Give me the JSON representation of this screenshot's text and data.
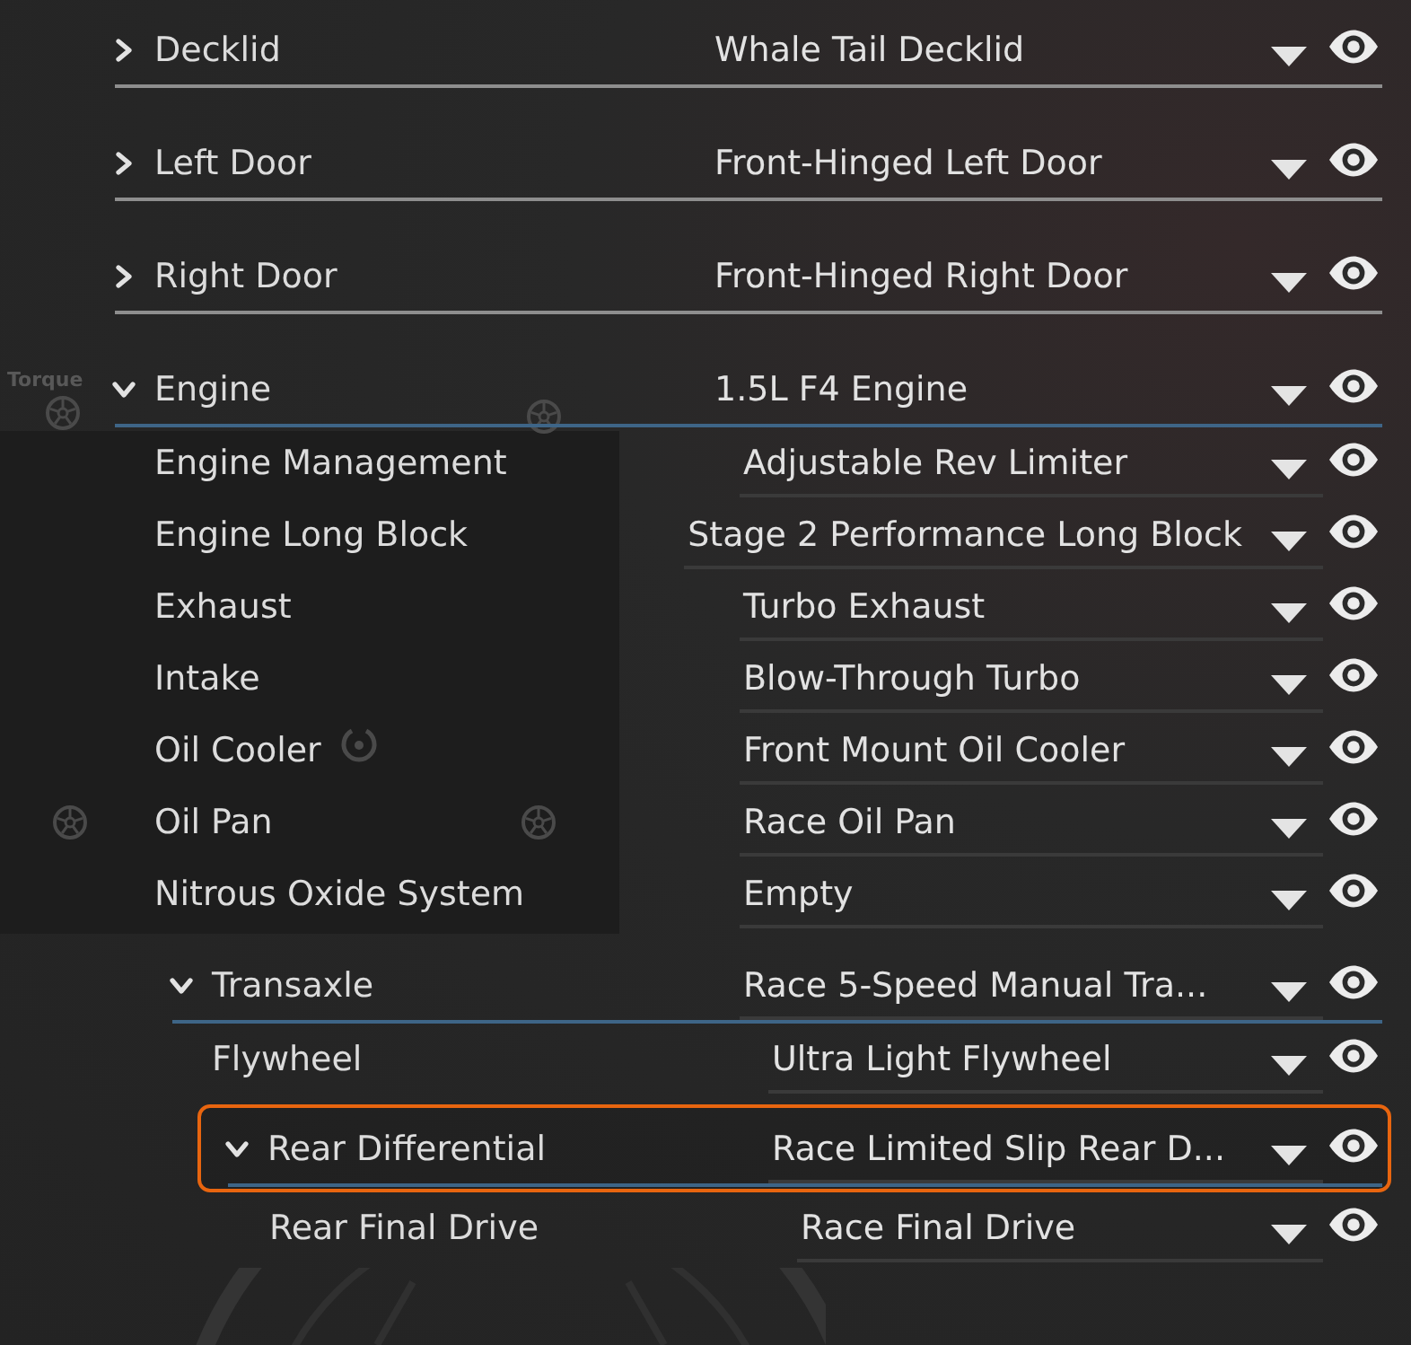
{
  "background": {
    "label": "Torque"
  },
  "parts": [
    {
      "label": "Decklid",
      "value": "Whale Tail Decklid",
      "expanded": false,
      "selected": false
    },
    {
      "label": "Left Door",
      "value": "Front-Hinged Left Door",
      "expanded": false,
      "selected": false
    },
    {
      "label": "Right Door",
      "value": "Front-Hinged Right Door",
      "expanded": false,
      "selected": false
    },
    {
      "label": "Engine",
      "value": "1.5L F4 Engine",
      "expanded": true,
      "selected": false,
      "children": [
        {
          "label": "Engine Management",
          "value": "Adjustable Rev Limiter",
          "selected": false
        },
        {
          "label": "Engine Long Block",
          "value": "Stage 2 Performance Long Block",
          "selected": false
        },
        {
          "label": "Exhaust",
          "value": "Turbo Exhaust",
          "selected": false
        },
        {
          "label": "Intake",
          "value": "Blow-Through Turbo",
          "selected": false
        },
        {
          "label": "Oil Cooler",
          "value": "Front Mount Oil Cooler",
          "selected": false
        },
        {
          "label": "Oil Pan",
          "value": "Race Oil Pan",
          "selected": false
        },
        {
          "label": "Nitrous Oxide System",
          "value": "Empty",
          "selected": false
        },
        {
          "label": "Transaxle",
          "value": "Race 5-Speed Manual Tra...",
          "expanded": true,
          "selected": false,
          "children": [
            {
              "label": "Flywheel",
              "value": "Ultra Light Flywheel",
              "selected": false
            },
            {
              "label": "Rear Differential",
              "value": "Race Limited Slip Rear D...",
              "expanded": true,
              "selected": true,
              "children": [
                {
                  "label": "Rear Final Drive",
                  "value": "Race Final Drive",
                  "selected": false
                }
              ]
            }
          ]
        }
      ]
    }
  ]
}
